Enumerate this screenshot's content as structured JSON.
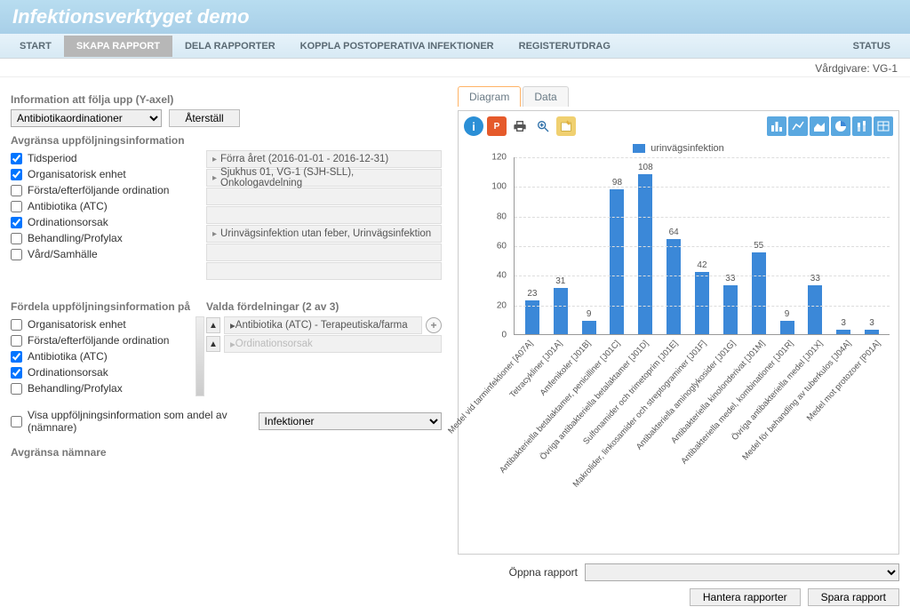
{
  "header": {
    "title": "Infektionsverktyget demo"
  },
  "nav": {
    "items": [
      "START",
      "SKAPA RAPPORT",
      "DELA RAPPORTER",
      "KOPPLA POSTOPERATIVA INFEKTIONER",
      "REGISTERUTDRAG"
    ],
    "active_index": 1,
    "status_label": "STATUS"
  },
  "subbar": {
    "text": "Vårdgivare: VG-1"
  },
  "left": {
    "yaxis_section": "Information att följa upp (Y-axel)",
    "yaxis_select_value": "Antibiotikaordinationer",
    "reset_label": "Återställ",
    "limit_header": "Avgränsa uppföljningsinformation",
    "limit_filters": [
      {
        "label": "Tidsperiod",
        "checked": true,
        "value": "Förra året (2016-01-01 - 2016-12-31)"
      },
      {
        "label": "Organisatorisk enhet",
        "checked": true,
        "value": "Sjukhus 01, VG-1 (SJH-SLL), Onkologavdelning"
      },
      {
        "label": "Första/efterföljande ordination",
        "checked": false,
        "value": ""
      },
      {
        "label": "Antibiotika (ATC)",
        "checked": false,
        "value": ""
      },
      {
        "label": "Ordinationsorsak",
        "checked": true,
        "value": "Urinvägsinfektion utan feber, Urinvägsinfektion"
      },
      {
        "label": "Behandling/Profylax",
        "checked": false,
        "value": ""
      },
      {
        "label": "Vård/Samhälle",
        "checked": false,
        "value": ""
      }
    ],
    "dist_header": "Fördela uppföljningsinformation på",
    "dist_chosen_header": "Valda fördelningar (2 av 3)",
    "dist_filters": [
      {
        "label": "Organisatorisk enhet",
        "checked": false
      },
      {
        "label": "Första/efterföljande ordination",
        "checked": false
      },
      {
        "label": "Antibiotika (ATC)",
        "checked": true
      },
      {
        "label": "Ordinationsorsak",
        "checked": true
      },
      {
        "label": "Behandling/Profylax",
        "checked": false
      }
    ],
    "dist_values": [
      {
        "text": "Antibiotika (ATC) - Terapeutiska/farma",
        "active": true
      },
      {
        "text": "Ordinationsorsak",
        "active": false
      }
    ],
    "share_checkbox_label": "Visa uppföljningsinformation som andel av (nämnare)",
    "share_select_value": "Infektioner",
    "limit_denom_header": "Avgränsa nämnare"
  },
  "right": {
    "tabs": [
      "Diagram",
      "Data"
    ],
    "active_tab": 0,
    "open_label": "Öppna rapport",
    "open_select_value": "",
    "manage_label": "Hantera rapporter",
    "save_label": "Spara rapport"
  },
  "chart_data": {
    "type": "bar",
    "title": "",
    "legend": [
      "urinvägsinfektion"
    ],
    "ylabel": "",
    "xlabel": "",
    "ylim": [
      0,
      120
    ],
    "yticks": [
      0,
      20,
      40,
      60,
      80,
      100,
      120
    ],
    "categories": [
      "Medel vid tarminfektioner [A07A]",
      "Tetracykliner [J01A]",
      "Amfenikoler [J01B]",
      "Antibakteriella betalaktamer, penicilliner [J01C]",
      "Övriga antibakteriella betalaktamer [J01D]",
      "Sulfonamider och trimetoprim [J01E]",
      "Makrolider, linkosamider och streptograminer [J01F]",
      "Antibakteriella aminoglykosider [J01G]",
      "Antibakteriella kinolonderivat [J01M]",
      "Antibakteriella medel, kombinationer [J01R]",
      "Övriga antibakteriella medel [J01X]",
      "Medel för behandling av tuberkulos [J04A]",
      "Medel mot protozoer [P01A]"
    ],
    "values": [
      23,
      31,
      9,
      98,
      108,
      64,
      42,
      33,
      55,
      9,
      33,
      3,
      3
    ],
    "series_color": "#3b88d8"
  }
}
